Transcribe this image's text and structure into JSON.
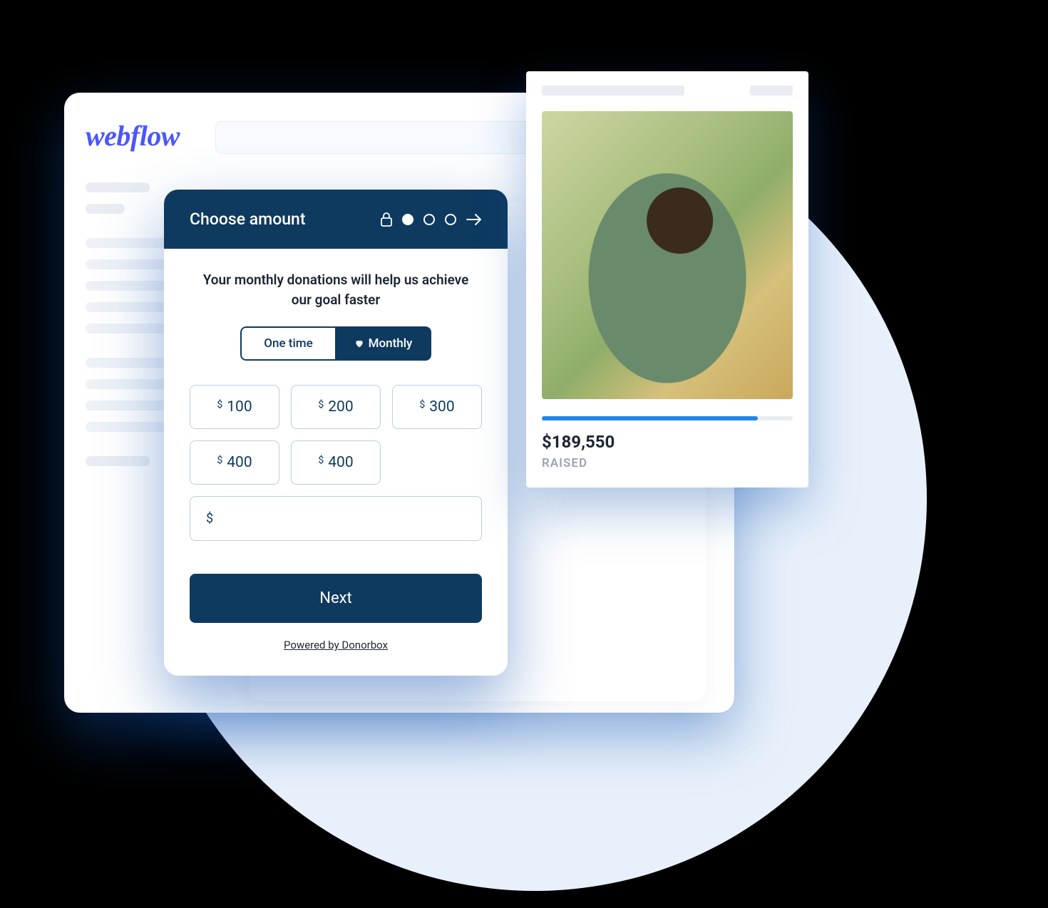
{
  "brand": {
    "webflow_logo": "webflow"
  },
  "donate": {
    "header_title": "Choose amount",
    "description": "Your monthly donations will help us achieve our goal faster",
    "freq": {
      "one_time": "One time",
      "monthly": "Monthly"
    },
    "currency_symbol": "$",
    "amounts": [
      "100",
      "200",
      "300",
      "400",
      "400"
    ],
    "next_label": "Next",
    "powered_by": "Powered by Donorbox"
  },
  "raised": {
    "amount": "$189,550",
    "label": "RAISED",
    "progress_percent": 86
  }
}
